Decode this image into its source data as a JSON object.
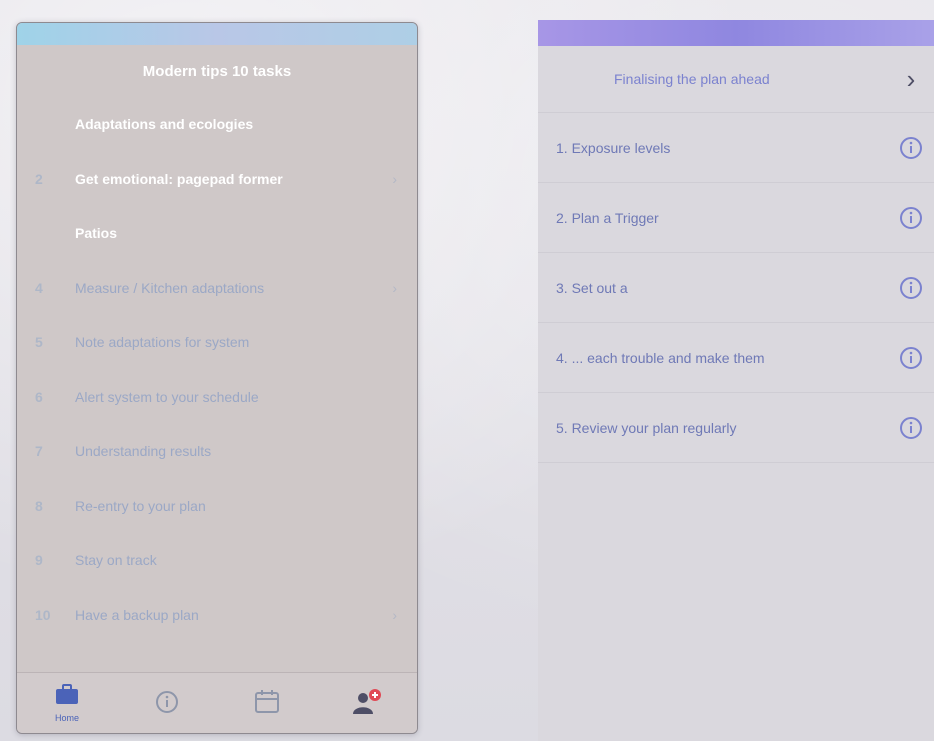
{
  "left_screen": {
    "title": "Modern tips 10 tasks",
    "steps": [
      {
        "num": "",
        "label": "Adaptations and ecologies",
        "state": "done"
      },
      {
        "num": "2",
        "label": "Get emotional: pagepad former",
        "state": "done"
      },
      {
        "num": "",
        "label": "Patios",
        "state": "done"
      },
      {
        "num": "4",
        "label": "Measure / Kitchen adaptations",
        "state": "todo"
      },
      {
        "num": "5",
        "label": "Note adaptations for system",
        "state": "todo"
      },
      {
        "num": "6",
        "label": "Alert system to your schedule",
        "state": "todo"
      },
      {
        "num": "7",
        "label": "Understanding results",
        "state": "todo"
      },
      {
        "num": "8",
        "label": "Re-entry to your plan",
        "state": "todo"
      },
      {
        "num": "9",
        "label": "Stay on track",
        "state": "todo"
      },
      {
        "num": "10",
        "label": "Have a backup plan",
        "state": "todo"
      }
    ],
    "tabs": [
      {
        "name": "home",
        "label": "Home",
        "icon": "briefcase-icon"
      },
      {
        "name": "info",
        "label": "",
        "icon": "info-icon"
      },
      {
        "name": "calendar",
        "label": "",
        "icon": "calendar-icon"
      },
      {
        "name": "profile",
        "label": "",
        "icon": "user-badge-icon"
      }
    ]
  },
  "right_screen": {
    "header": "Finalising the plan ahead",
    "items": [
      {
        "label": "1. Exposure levels"
      },
      {
        "label": "2. Plan a Trigger"
      },
      {
        "label": "3. Set out a"
      },
      {
        "label": "4. ... each trouble and make them"
      },
      {
        "label": "5. Review your plan regularly"
      }
    ]
  },
  "colors": {
    "accent": "#4b63b8",
    "purple_bar": "#8f87e0",
    "top_bar_left": "#a8cfe6",
    "badge": "#e04a55"
  }
}
